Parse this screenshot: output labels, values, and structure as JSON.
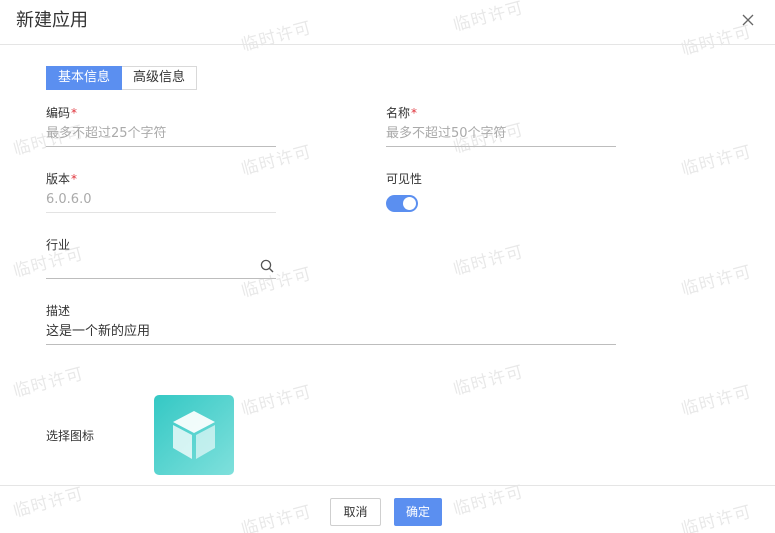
{
  "dialog": {
    "title": "新建应用"
  },
  "tabs": [
    {
      "label": "基本信息",
      "active": true
    },
    {
      "label": "高级信息",
      "active": false
    }
  ],
  "form": {
    "code": {
      "label": "编码",
      "required_mark": "*",
      "placeholder": "最多不超过25个字符",
      "value": ""
    },
    "name": {
      "label": "名称",
      "required_mark": "*",
      "placeholder": "最多不超过50个字符",
      "value": ""
    },
    "version": {
      "label": "版本",
      "required_mark": "*",
      "value": "6.0.6.0"
    },
    "visibility": {
      "label": "可见性",
      "on": true
    },
    "industry": {
      "label": "行业",
      "value": ""
    },
    "description": {
      "label": "描述",
      "value": "这是一个新的应用"
    },
    "icon": {
      "label": "选择图标",
      "icon_name": "cube-icon",
      "gradient": [
        "#34c8c4",
        "#7fe0dc"
      ]
    }
  },
  "footer": {
    "cancel_label": "取消",
    "ok_label": "确定"
  },
  "watermark": "临时许可",
  "colors": {
    "primary": "#5b8ff0",
    "required": "#e0343c"
  }
}
